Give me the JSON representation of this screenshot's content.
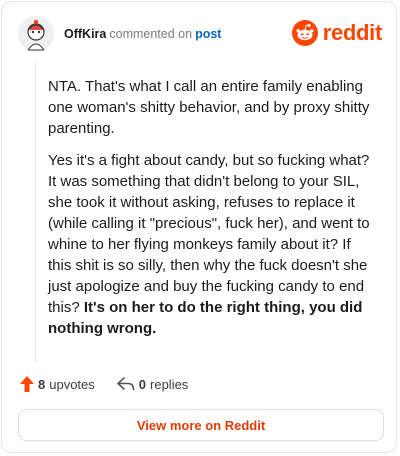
{
  "comment": {
    "author": "OffKira",
    "verb": "commented on",
    "post_link": "post",
    "paragraphs": [
      "NTA. That's what I call an entire family enabling one woman's shitty behavior, and by proxy shitty parenting.",
      "Yes it's a fight about candy, but so fucking what? It was something that didn't belong to your SIL, she took it without asking, refuses to replace it (while calling it \"precious\", fuck her), and went to whine to her flying monkeys family about it? If this shit is so silly, then why the fuck doesn't she just apologize and buy the fucking candy to end this?"
    ],
    "bold_tail": "It's on her to do the right thing, you did nothing wrong."
  },
  "brand": {
    "name": "reddit",
    "color": "#ff4500"
  },
  "actions": {
    "upvotes_count": "8",
    "upvotes_label": "upvotes",
    "replies_count": "0",
    "replies_label": "replies"
  },
  "footer": {
    "view_label": "View more on Reddit"
  }
}
